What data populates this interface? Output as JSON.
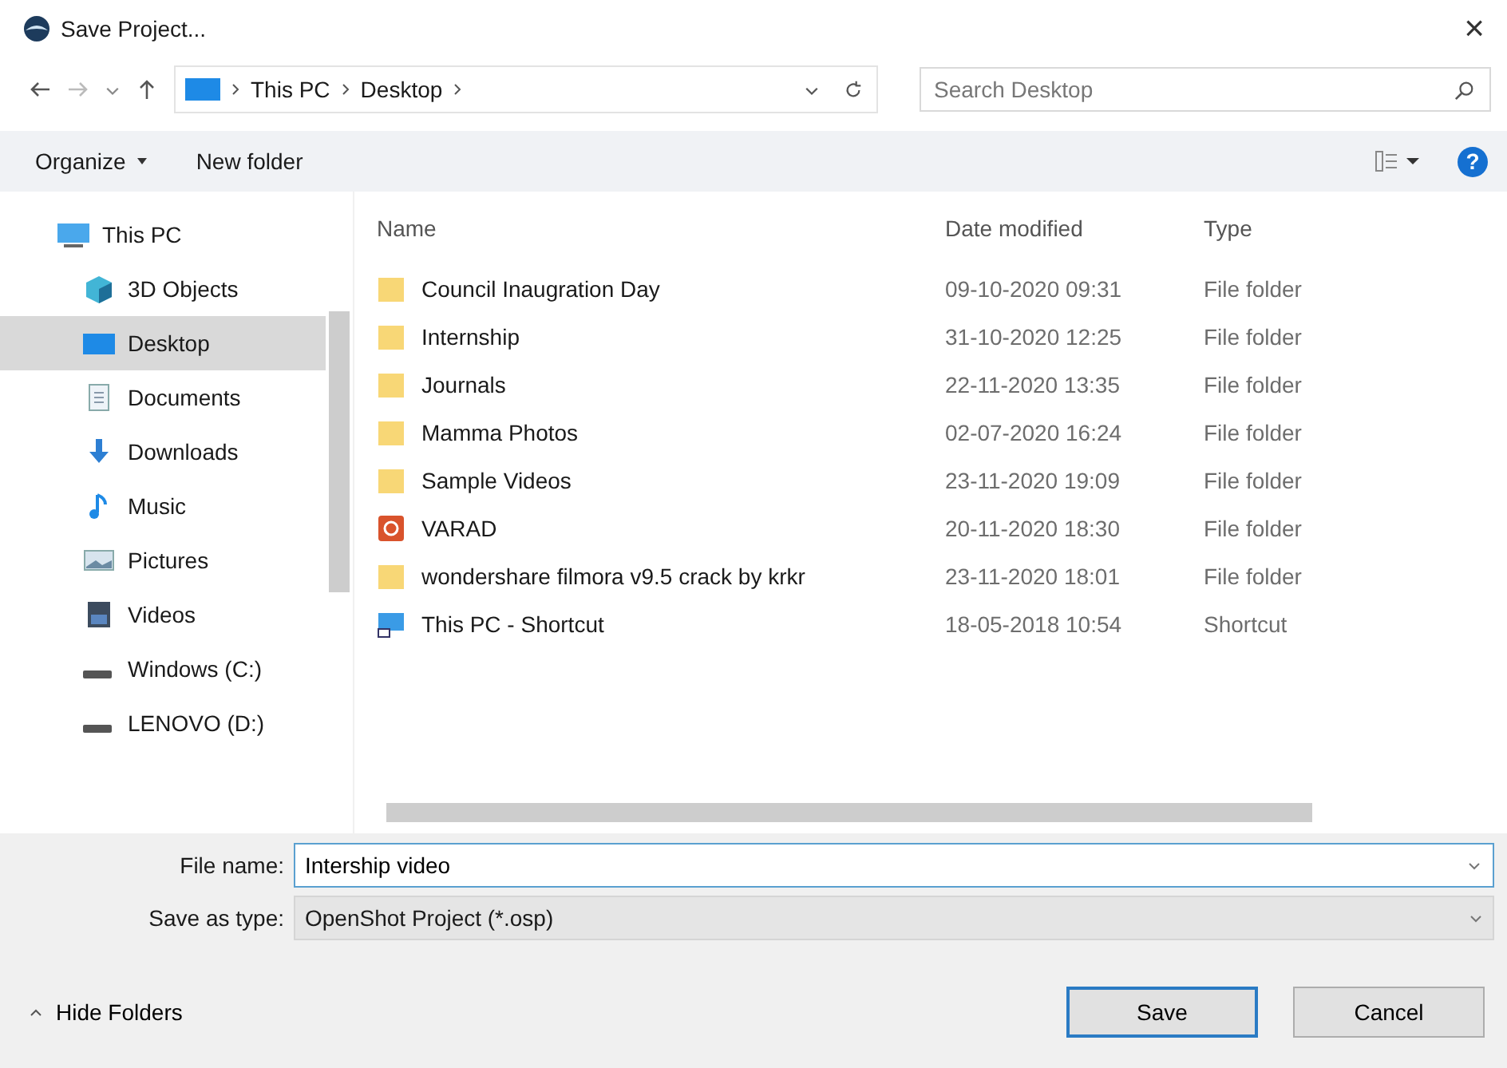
{
  "window": {
    "title": "Save Project...",
    "close": "×"
  },
  "nav": {
    "path": [
      "This PC",
      "Desktop"
    ],
    "search": {
      "placeholder": "Search Desktop"
    }
  },
  "toolbar": {
    "organize": "Organize",
    "new_folder": "New folder",
    "help": "?"
  },
  "sidebar": {
    "items": [
      {
        "label": "This PC",
        "kind": "pc",
        "selected": false
      },
      {
        "label": "3D Objects",
        "kind": "cube",
        "selected": false
      },
      {
        "label": "Desktop",
        "kind": "desktop",
        "selected": true
      },
      {
        "label": "Documents",
        "kind": "doc",
        "selected": false
      },
      {
        "label": "Downloads",
        "kind": "download",
        "selected": false
      },
      {
        "label": "Music",
        "kind": "music",
        "selected": false
      },
      {
        "label": "Pictures",
        "kind": "pictures",
        "selected": false
      },
      {
        "label": "Videos",
        "kind": "videos",
        "selected": false
      },
      {
        "label": "Windows (C:)",
        "kind": "drive",
        "selected": false
      },
      {
        "label": "LENOVO (D:)",
        "kind": "drive",
        "selected": false
      }
    ]
  },
  "table": {
    "columns": [
      "Name",
      "Date modified",
      "Type"
    ],
    "rows": [
      {
        "name": "Council Inaugration Day",
        "date": "09-10-2020 09:31",
        "type": "File folder",
        "kind": "folder"
      },
      {
        "name": "Internship",
        "date": "31-10-2020 12:25",
        "type": "File folder",
        "kind": "folder"
      },
      {
        "name": "Journals",
        "date": "22-11-2020 13:35",
        "type": "File folder",
        "kind": "folder"
      },
      {
        "name": "Mamma Photos",
        "date": "02-07-2020 16:24",
        "type": "File folder",
        "kind": "folder"
      },
      {
        "name": "Sample Videos",
        "date": "23-11-2020 19:09",
        "type": "File folder",
        "kind": "folder"
      },
      {
        "name": "VARAD",
        "date": "20-11-2020 18:30",
        "type": "File folder",
        "kind": "app"
      },
      {
        "name": "wondershare filmora v9.5 crack by krkr",
        "date": "23-11-2020 18:01",
        "type": "File folder",
        "kind": "folder"
      },
      {
        "name": "This PC - Shortcut",
        "date": "18-05-2018 10:54",
        "type": "Shortcut",
        "kind": "shortcut"
      }
    ]
  },
  "form": {
    "file_name": {
      "label": "File name:",
      "value": "Intership video"
    },
    "save_type": {
      "label": "Save as type:",
      "value": "OpenShot Project (*.osp)"
    }
  },
  "footer": {
    "hide_folders": "Hide Folders",
    "buttons": [
      "Save",
      "Cancel"
    ]
  }
}
